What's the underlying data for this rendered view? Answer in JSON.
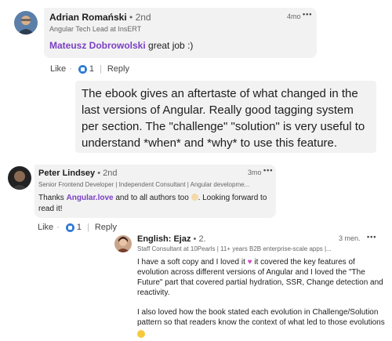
{
  "comment1": {
    "author": "Adrian Romański",
    "degree": "• 2nd",
    "headline": "Angular Tech Lead at InsERT",
    "time": "4mo",
    "more": "•••",
    "mention": "Mateusz Dobrowolski",
    "text": "great job :)",
    "like_label": "Like",
    "like_count": "1",
    "reply_label": "Reply"
  },
  "quote": {
    "text": "The ebook gives an aftertaste of what changed in the last versions of Angular. Really good tagging system per section. The \"challenge\" \"solution\" is very useful to understand *when* and *why* to use this feature."
  },
  "comment2": {
    "author": "Peter Lindsey",
    "degree": "• 2nd",
    "headline": "Senior Frontend Developer | Independent Consultant | Angular developme...",
    "time": "3mo",
    "more": "•••",
    "text_before": "Thanks",
    "mention": "Angular.love",
    "text_after": "and to all authors too",
    "text_tail": ". Looking forward to read it!",
    "like_label": "Like",
    "like_count": "1",
    "reply_label": "Reply"
  },
  "comment3": {
    "author": "English: Ejaz",
    "degree": "• 2.",
    "headline": "Staff Consultant at 10Pearls | 11+ years B2B enterprise-scale apps |...",
    "time": "3 men.",
    "more": "•••",
    "para1_a": "I have a soft copy and I loved it",
    "para1_b": "it covered the key features of evolution across different versions of Angular and I loved the \"The Future\" part that covered partial hydration, SSR, Change detection and reactivity.",
    "para2": "I also loved how the book stated each evolution in Challenge/Solution pattern so that readers know the context of what led to those evolutions"
  },
  "colors": {
    "mention": "#7b3fc4",
    "like_blue": "#2f7bd6",
    "bubble_bg": "#f2f2f2"
  }
}
